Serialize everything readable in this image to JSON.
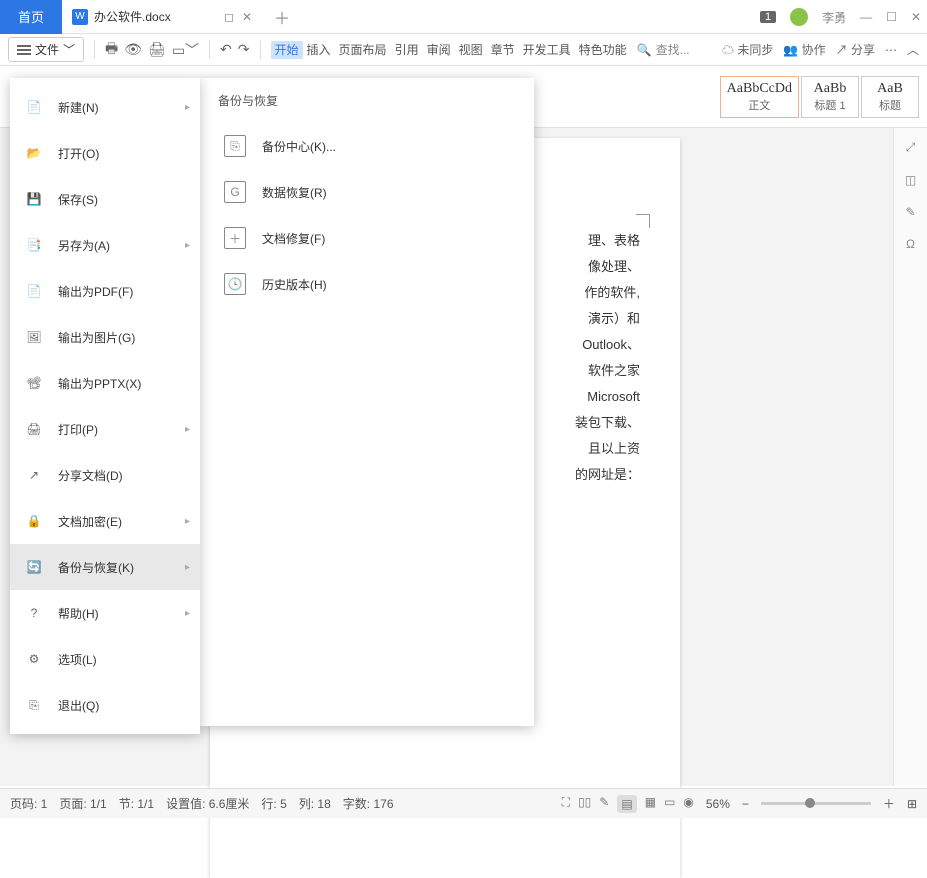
{
  "titlebar": {
    "home": "首页",
    "doc_name": "办公软件.docx",
    "badge": "1",
    "user": "李勇"
  },
  "toolbar": {
    "file": "文件",
    "tabs": [
      "开始",
      "插入",
      "页面布局",
      "引用",
      "审阅",
      "视图",
      "章节",
      "开发工具",
      "特色功能"
    ],
    "search": "查找...",
    "sync": "未同步",
    "collab": "协作",
    "share": "分享"
  },
  "styles": [
    {
      "preview": "AaBbCcDd",
      "label": "正文"
    },
    {
      "preview": "AaBb",
      "label": "标题 1"
    },
    {
      "preview": "AaB",
      "label": "标题"
    }
  ],
  "file_menu": [
    {
      "label": "新建(N)",
      "arrow": true,
      "icon": "new"
    },
    {
      "label": "打开(O)",
      "arrow": false,
      "icon": "open"
    },
    {
      "label": "保存(S)",
      "arrow": false,
      "icon": "save"
    },
    {
      "label": "另存为(A)",
      "arrow": true,
      "icon": "saveas"
    },
    {
      "label": "输出为PDF(F)",
      "arrow": false,
      "icon": "pdf"
    },
    {
      "label": "输出为图片(G)",
      "arrow": false,
      "icon": "img"
    },
    {
      "label": "输出为PPTX(X)",
      "arrow": false,
      "icon": "pptx"
    },
    {
      "label": "打印(P)",
      "arrow": true,
      "icon": "print"
    },
    {
      "label": "分享文档(D)",
      "arrow": false,
      "icon": "share"
    },
    {
      "label": "文档加密(E)",
      "arrow": true,
      "icon": "lock"
    },
    {
      "label": "备份与恢复(K)",
      "arrow": true,
      "icon": "backup",
      "active": true
    },
    {
      "label": "帮助(H)",
      "arrow": true,
      "icon": "help"
    },
    {
      "label": "选项(L)",
      "arrow": false,
      "icon": "options"
    },
    {
      "label": "退出(Q)",
      "arrow": false,
      "icon": "exit"
    }
  ],
  "submenu": {
    "title": "备份与恢复",
    "items": [
      {
        "label": "备份中心(K)..."
      },
      {
        "label": "数据恢复(R)"
      },
      {
        "label": "文档修复(F)"
      },
      {
        "label": "历史版本(H)"
      }
    ]
  },
  "document_lines": [
    "理、表格",
    "像处理、",
    "作的软件,",
    "演示）和",
    "Outlook、",
    "软件之家",
    "Microsoft",
    "装包下载、",
    "且以上资",
    "的网址是："
  ],
  "status": {
    "page_no": "页码: 1",
    "pages": "页面: 1/1",
    "section": "节: 1/1",
    "setval": "设置值: 6.6厘米",
    "row": "行: 5",
    "col": "列: 18",
    "words": "字数: 176",
    "zoom": "56%"
  }
}
